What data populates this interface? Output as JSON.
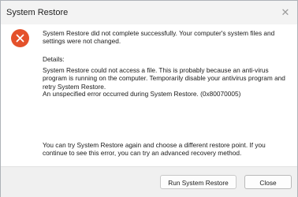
{
  "window": {
    "title": "System Restore",
    "close_glyph": "✕"
  },
  "message": {
    "main": "System Restore did not complete successfully. Your computer's system files and settings were not changed.",
    "details_heading": "Details:",
    "details": "System Restore could not access a file. This is probably because an anti-virus program is running on the computer. Temporarily disable your antivirus program and retry System Restore.",
    "error": "An unspecified error occurred during System Restore. (0x80070005)",
    "try_again": "You can try System Restore again and choose a different restore point. If you continue to see this error, you can try an advanced recovery method."
  },
  "buttons": {
    "run_label": "Run System Restore",
    "close_label": "Close"
  },
  "icons": {
    "error": "error-icon",
    "error_color": "#e4512b"
  }
}
